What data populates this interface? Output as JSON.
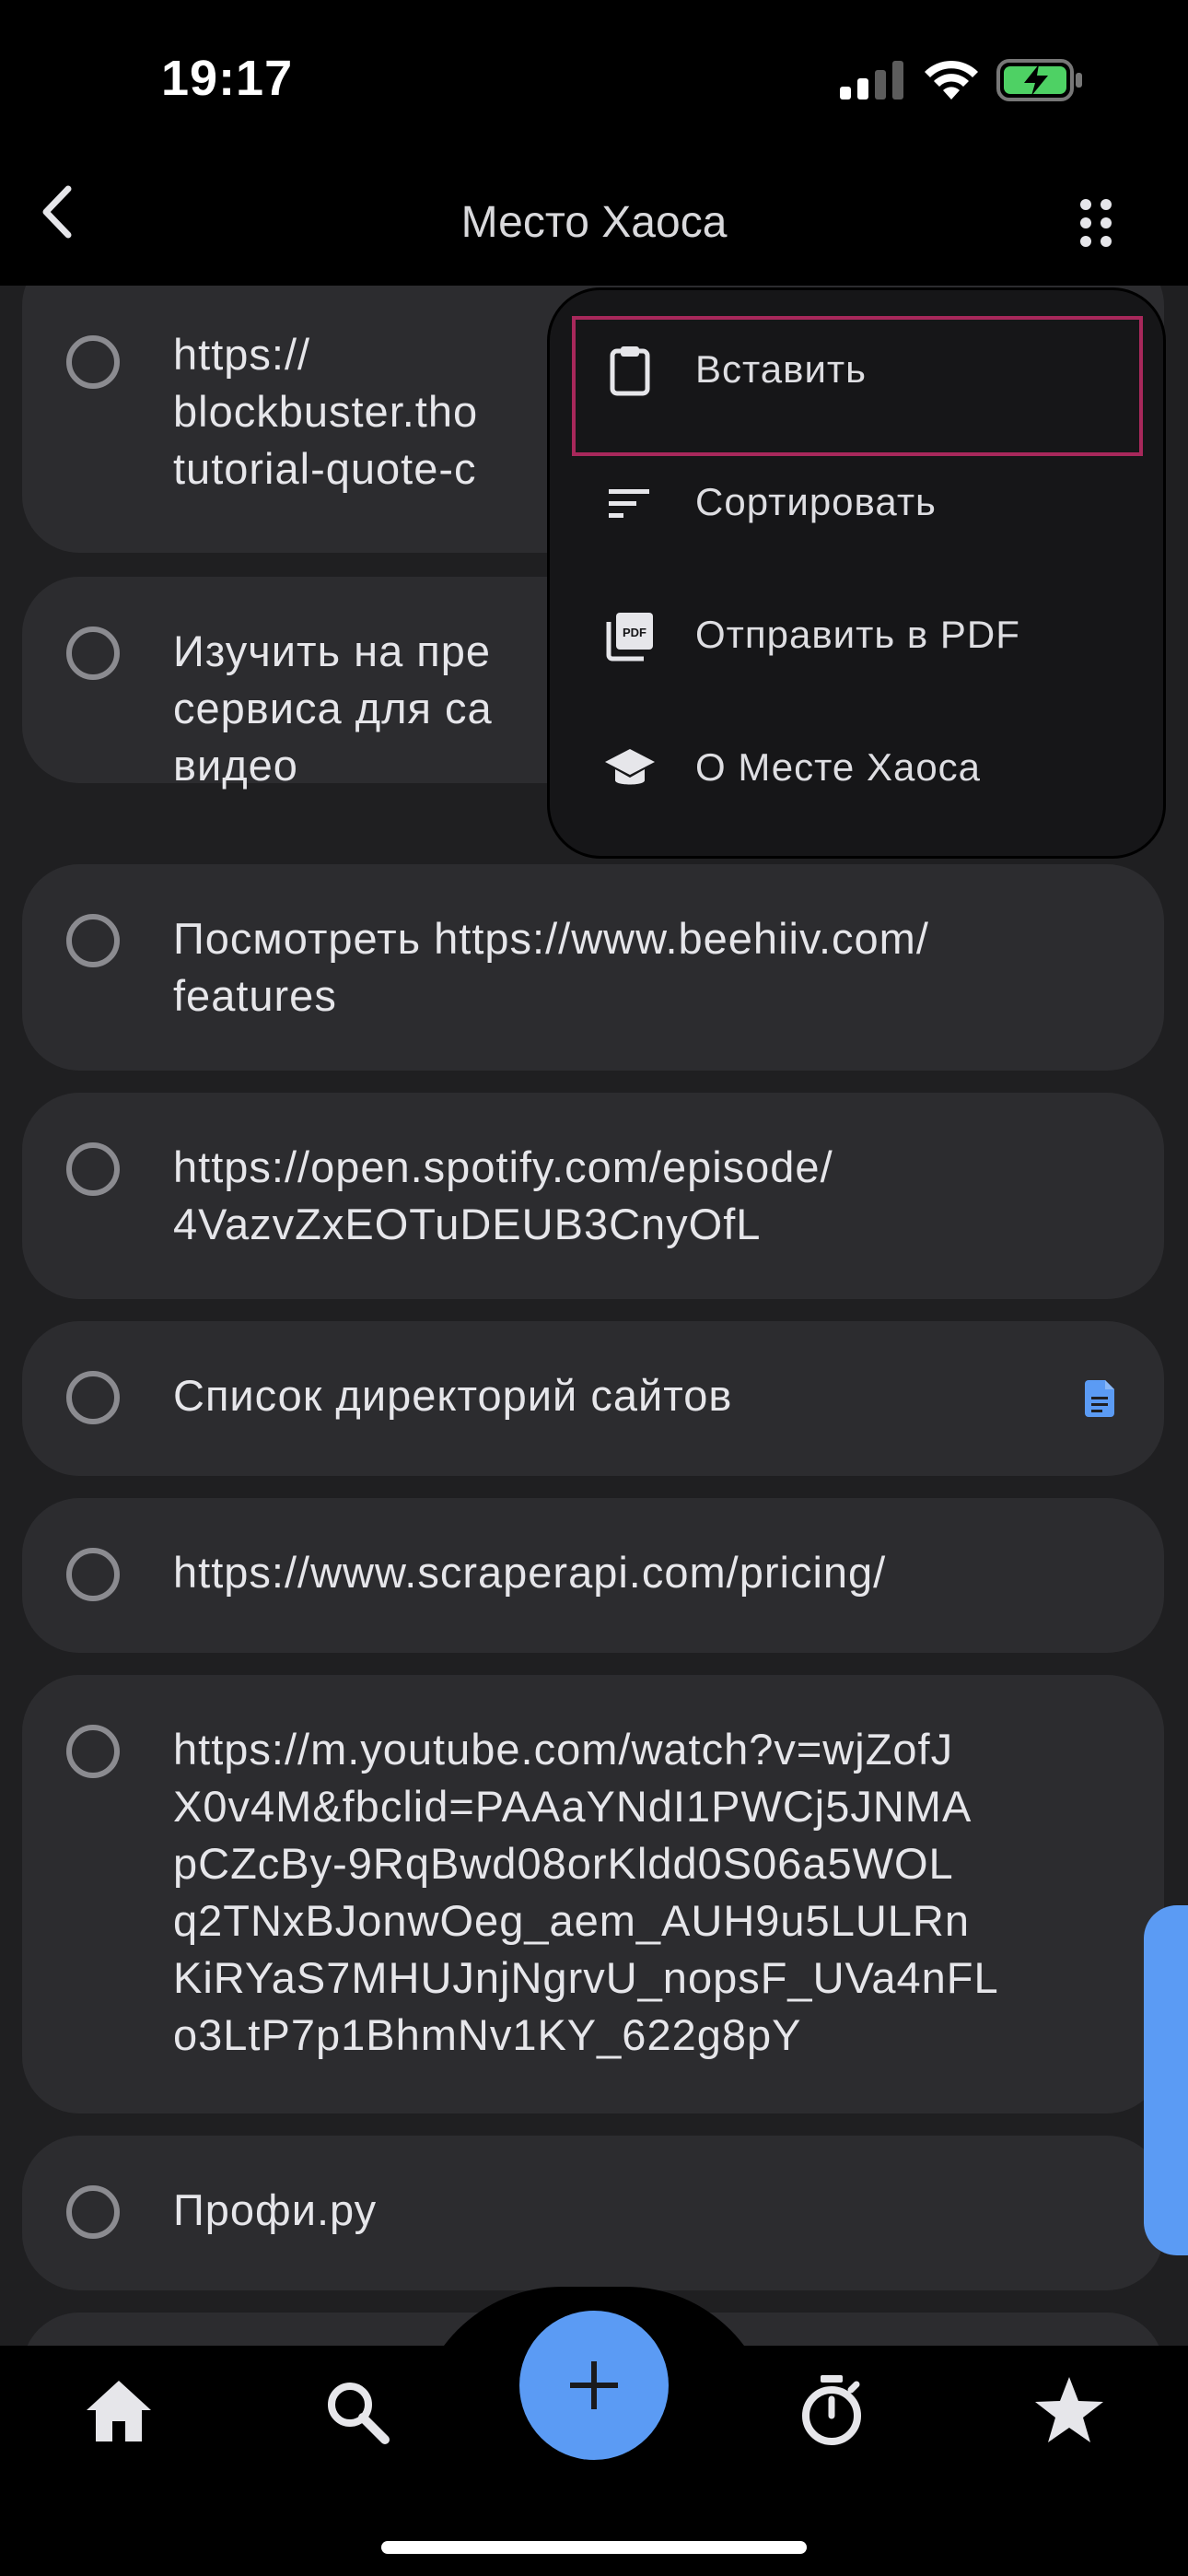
{
  "status_bar": {
    "time": "19:17"
  },
  "header": {
    "title": "Место Хаоса",
    "back_icon": "chevron-left-icon",
    "menu_icon": "more-grid-icon"
  },
  "menu": {
    "items": [
      {
        "label": "Вставить",
        "icon": "clipboard-icon"
      },
      {
        "label": "Сортировать",
        "icon": "sort-icon"
      },
      {
        "label": "Отправить в PDF",
        "icon": "pdf-icon"
      },
      {
        "label": "О Месте Хаоса",
        "icon": "graduation-cap-icon"
      }
    ]
  },
  "tasks": [
    {
      "text": "https://\nblockbuster.tho\ntutorial-quote-c"
    },
    {
      "text": "Изучить на пре\nсервиса для са\nвидео"
    },
    {
      "text": "Посмотреть https://www.beehiiv.com/\nfeatures"
    },
    {
      "text": "https://open.spotify.com/episode/\n4VazvZxEOTuDEUB3CnyOfL"
    },
    {
      "text": "Список директорий сайтов",
      "has_note": true
    },
    {
      "text": "https://www.scraperapi.com/pricing/"
    },
    {
      "text": "https://m.youtube.com/watch?v=wjZofJ\nX0v4M&fbclid=PAAaYNdI1PWCj5JNMA\npCZcBy-9RqBwd08orKldd0S06a5WOL\nq2TNxBJonwOeg_aem_AUH9u5LULRn\nKiRYaS7MHUJnjNgrvU_nopsF_UVa4nFL\no3LtP7p1BhmNv1KY_622g8pY"
    },
    {
      "text": "Профи.ру"
    }
  ],
  "bottom_nav": {
    "items": [
      "home-icon",
      "search-icon",
      "add-icon",
      "timer-icon",
      "star-icon"
    ]
  },
  "colors": {
    "accent": "#5b9bf4",
    "highlight": "#a8285b",
    "card": "#2c2c2f"
  }
}
